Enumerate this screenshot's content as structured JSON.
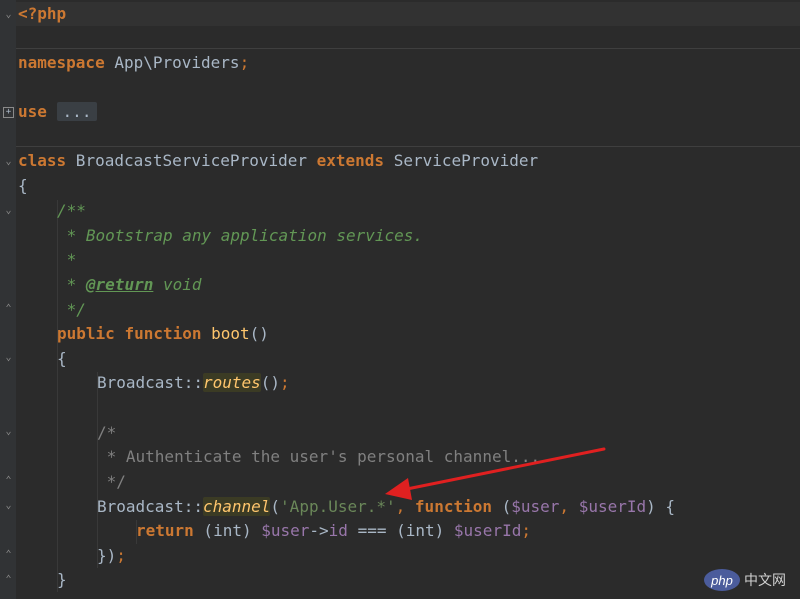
{
  "editor": {
    "colors": {
      "background": "#2b2b2b",
      "gutter": "#313335",
      "keyword": "#cc7832",
      "function": "#ffc66d",
      "string": "#6a8759",
      "variable": "#9876aa",
      "comment": "#808080",
      "doc_comment": "#629755",
      "arrow": "#e02020"
    },
    "code": {
      "php_open": "<?php",
      "ns_kw": "namespace",
      "ns_name": " App\\Providers",
      "semi": ";",
      "use_kw": "use",
      "use_folded": "...",
      "class_kw": "class",
      "class_name": " BroadcastServiceProvider ",
      "extends_kw": "extends",
      "parent": " ServiceProvider",
      "brace_open": "{",
      "doc_open": "/**",
      "doc_line1": " * Bootstrap any application services.",
      "doc_line2": " *",
      "doc_line3_prefix": " * ",
      "doc_tag": "@return",
      "doc_line3_suffix": " void",
      "doc_close": " */",
      "public_kw": "public",
      "function_kw": "function",
      "boot_name": "boot",
      "boot_parens": "()",
      "routes_class": "Broadcast::",
      "routes_method": "routes",
      "routes_call": "()",
      "cmt_open": "/*",
      "cmt_line1": " * Authenticate the user's personal channel...",
      "cmt_close": " */",
      "channel_class": "Broadcast::",
      "channel_method": "channel",
      "paren_open": "(",
      "channel_string": "'App.User.*'",
      "comma": ",",
      "paren_args_open": " (",
      "var_user": "$user",
      "comma_space": ", ",
      "var_userid": "$userId",
      "paren_args_close": ") {",
      "return_kw": "return",
      "cast1": " (int) ",
      "var_user_id": "$user",
      "arrow_op": "->",
      "prop_id": "id",
      "ident_op": " === ",
      "cast2": "(int) ",
      "var_userid2": "$userId",
      "closure_close": "})",
      "brace_close": "}"
    }
  },
  "watermark": {
    "logo": "php",
    "text": "中文网"
  }
}
